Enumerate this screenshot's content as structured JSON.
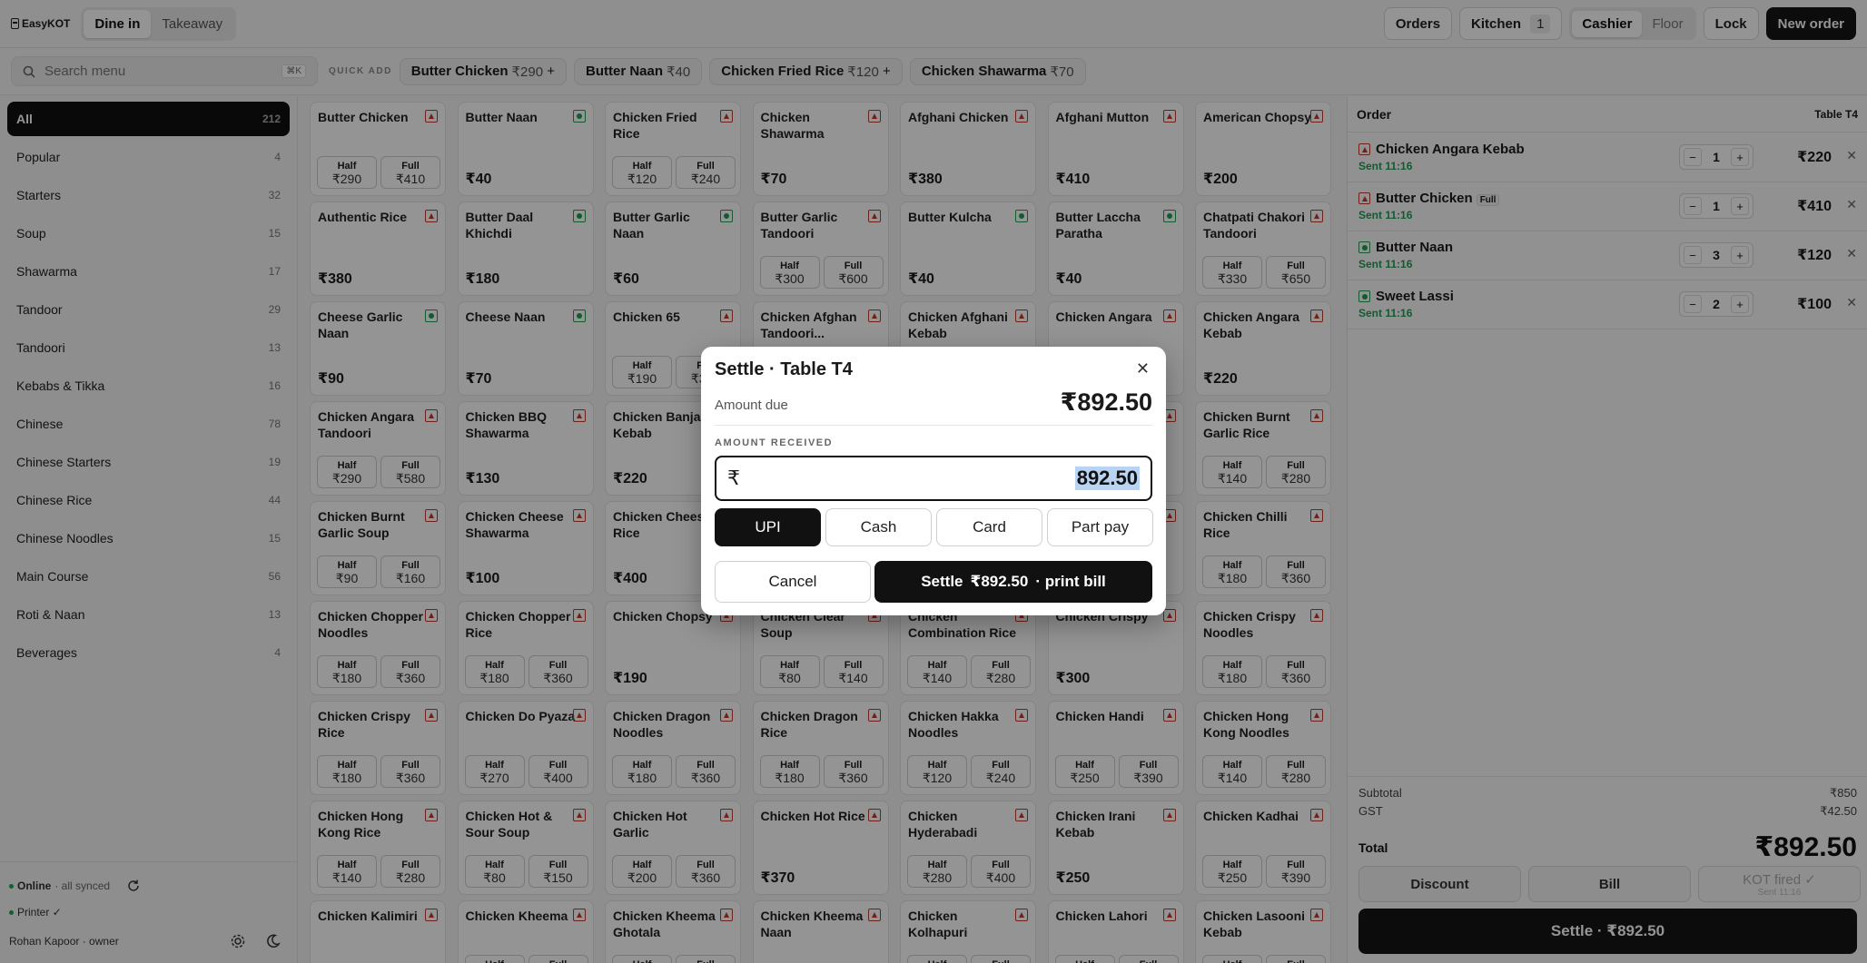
{
  "app": {
    "name": "EasyKOT"
  },
  "modes": [
    {
      "label": "Dine in",
      "active": true
    },
    {
      "label": "Takeaway",
      "active": false
    }
  ],
  "topbar": {
    "orders": "Orders",
    "kitchen": "Kitchen",
    "kitchen_count": "1",
    "roles": [
      {
        "label": "Cashier",
        "active": true
      },
      {
        "label": "Floor",
        "active": false
      }
    ],
    "lock": "Lock",
    "new_order": "New order"
  },
  "search": {
    "placeholder": "Search menu",
    "shortcut": "⌘K"
  },
  "quick_add": {
    "label": "QUICK ADD",
    "items": [
      {
        "name": "Butter Chicken",
        "price": "₹290",
        "more": "+"
      },
      {
        "name": "Butter Naan",
        "price": "₹40",
        "more": ""
      },
      {
        "name": "Chicken Fried Rice",
        "price": "₹120",
        "more": "+"
      },
      {
        "name": "Chicken Shawarma",
        "price": "₹70",
        "more": ""
      }
    ]
  },
  "categories": [
    {
      "label": "All",
      "count": "212",
      "active": true
    },
    {
      "label": "Popular",
      "count": "4"
    },
    {
      "label": "Starters",
      "count": "32"
    },
    {
      "label": "Soup",
      "count": "15"
    },
    {
      "label": "Shawarma",
      "count": "17"
    },
    {
      "label": "Tandoor",
      "count": "29"
    },
    {
      "label": "Tandoori",
      "count": "13"
    },
    {
      "label": "Kebabs & Tikka",
      "count": "16"
    },
    {
      "label": "Chinese",
      "count": "78"
    },
    {
      "label": "Chinese Starters",
      "count": "19"
    },
    {
      "label": "Chinese Rice",
      "count": "44"
    },
    {
      "label": "Chinese Noodles",
      "count": "15"
    },
    {
      "label": "Main Course",
      "count": "56"
    },
    {
      "label": "Roti & Naan",
      "count": "13"
    },
    {
      "label": "Beverages",
      "count": "4"
    }
  ],
  "status": {
    "online": "Online",
    "synced": "· all synced",
    "printer": "Printer ✓",
    "user": "Rohan Kapoor · owner"
  },
  "menu": [
    {
      "name": "Butter Chicken",
      "veg": false,
      "half": "₹290",
      "full": "₹410"
    },
    {
      "name": "Butter Naan",
      "veg": true,
      "price": "₹40"
    },
    {
      "name": "Chicken Fried Rice",
      "veg": false,
      "half": "₹120",
      "full": "₹240"
    },
    {
      "name": "Chicken Shawarma",
      "veg": false,
      "price": "₹70"
    },
    {
      "name": "Afghani Chicken",
      "veg": false,
      "price": "₹380"
    },
    {
      "name": "Afghani Mutton",
      "veg": false,
      "price": "₹410"
    },
    {
      "name": "American Chopsy",
      "veg": false,
      "price": "₹200"
    },
    {
      "name": "Authentic Rice",
      "veg": false,
      "price": "₹380"
    },
    {
      "name": "Butter Daal Khichdi",
      "veg": true,
      "price": "₹180"
    },
    {
      "name": "Butter Garlic Naan",
      "veg": true,
      "price": "₹60"
    },
    {
      "name": "Butter Garlic Tandoori",
      "veg": false,
      "half": "₹300",
      "full": "₹600"
    },
    {
      "name": "Butter Kulcha",
      "veg": true,
      "price": "₹40"
    },
    {
      "name": "Butter Laccha Paratha",
      "veg": true,
      "price": "₹40"
    },
    {
      "name": "Chatpati Chakori Tandoori",
      "veg": false,
      "half": "₹330",
      "full": "₹650"
    },
    {
      "name": "Cheese Garlic Naan",
      "veg": true,
      "price": "₹90"
    },
    {
      "name": "Cheese Naan",
      "veg": true,
      "price": "₹70"
    },
    {
      "name": "Chicken 65",
      "veg": false,
      "half": "₹190",
      "full": "₹380"
    },
    {
      "name": "Chicken Afghan Tandoori...",
      "veg": false,
      "price": ""
    },
    {
      "name": "Chicken Afghani Kebab",
      "veg": false,
      "price": ""
    },
    {
      "name": "Chicken Angara",
      "veg": false,
      "price": ""
    },
    {
      "name": "Chicken Angara Kebab",
      "veg": false,
      "price": "₹220"
    },
    {
      "name": "Chicken Angara Tandoori",
      "veg": false,
      "half": "₹290",
      "full": "₹580"
    },
    {
      "name": "Chicken BBQ Shawarma",
      "veg": false,
      "price": "₹130"
    },
    {
      "name": "Chicken Banjara Kebab",
      "veg": false,
      "price": "₹220"
    },
    {
      "name": "",
      "veg": false,
      "price": ""
    },
    {
      "name": "",
      "veg": false,
      "price": ""
    },
    {
      "name": "",
      "veg": false,
      "price": ""
    },
    {
      "name": "Chicken Burnt Garlic Rice",
      "veg": false,
      "half": "₹140",
      "full": "₹280"
    },
    {
      "name": "Chicken Burnt Garlic Soup",
      "veg": false,
      "half": "₹90",
      "full": "₹160"
    },
    {
      "name": "Chicken Cheese Shawarma",
      "veg": false,
      "price": "₹100"
    },
    {
      "name": "Chicken Cheese Rice",
      "veg": false,
      "price": "₹400"
    },
    {
      "name": "",
      "veg": false,
      "price": ""
    },
    {
      "name": "",
      "veg": false,
      "price": ""
    },
    {
      "name": "",
      "veg": false,
      "price": ""
    },
    {
      "name": "Chicken Chilli Rice",
      "veg": false,
      "half": "₹180",
      "full": "₹360"
    },
    {
      "name": "Chicken Chopper Noodles",
      "veg": false,
      "half": "₹180",
      "full": "₹360"
    },
    {
      "name": "Chicken Chopper Rice",
      "veg": false,
      "half": "₹180",
      "full": "₹360"
    },
    {
      "name": "Chicken Chopsy",
      "veg": false,
      "price": "₹190"
    },
    {
      "name": "Chicken Clear Soup",
      "veg": false,
      "half": "₹80",
      "full": "₹140"
    },
    {
      "name": "Chicken Combination Rice",
      "veg": false,
      "half": "₹140",
      "full": "₹280"
    },
    {
      "name": "Chicken Crispy",
      "veg": false,
      "price": "₹300"
    },
    {
      "name": "Chicken Crispy Noodles",
      "veg": false,
      "half": "₹180",
      "full": "₹360"
    },
    {
      "name": "Chicken Crispy Rice",
      "veg": false,
      "half": "₹180",
      "full": "₹360"
    },
    {
      "name": "Chicken Do Pyaza",
      "veg": false,
      "half": "₹270",
      "full": "₹400"
    },
    {
      "name": "Chicken Dragon Noodles",
      "veg": false,
      "half": "₹180",
      "full": "₹360"
    },
    {
      "name": "Chicken Dragon Rice",
      "veg": false,
      "half": "₹180",
      "full": "₹360"
    },
    {
      "name": "Chicken Hakka Noodles",
      "veg": false,
      "half": "₹120",
      "full": "₹240"
    },
    {
      "name": "Chicken Handi",
      "veg": false,
      "half": "₹250",
      "full": "₹390"
    },
    {
      "name": "Chicken Hong Kong Noodles",
      "veg": false,
      "half": "₹140",
      "full": "₹280"
    },
    {
      "name": "Chicken Hong Kong Rice",
      "veg": false,
      "half": "₹140",
      "full": "₹280"
    },
    {
      "name": "Chicken Hot & Sour Soup",
      "veg": false,
      "half": "₹80",
      "full": "₹150"
    },
    {
      "name": "Chicken Hot Garlic",
      "veg": false,
      "half": "₹200",
      "full": "₹360"
    },
    {
      "name": "Chicken Hot Rice",
      "veg": false,
      "price": "₹370"
    },
    {
      "name": "Chicken Hyderabadi",
      "veg": false,
      "half": "₹280",
      "full": "₹400"
    },
    {
      "name": "Chicken Irani Kebab",
      "veg": false,
      "price": "₹250"
    },
    {
      "name": "Chicken Kadhai",
      "veg": false,
      "half": "₹250",
      "full": "₹390"
    },
    {
      "name": "Chicken Kalimiri",
      "veg": false,
      "price": ""
    },
    {
      "name": "Chicken Kheema",
      "veg": false,
      "half": "",
      "full": ""
    },
    {
      "name": "Chicken Kheema Ghotala",
      "veg": false,
      "half": "",
      "full": ""
    },
    {
      "name": "Chicken Kheema Naan",
      "veg": false,
      "price": ""
    },
    {
      "name": "Chicken Kolhapuri",
      "veg": false,
      "half": "",
      "full": ""
    },
    {
      "name": "Chicken Lahori",
      "veg": false,
      "half": "",
      "full": ""
    },
    {
      "name": "Chicken Lasooni Kebab",
      "veg": false,
      "half": "",
      "full": ""
    }
  ],
  "variant_labels": {
    "half": "Half",
    "full": "Full"
  },
  "order": {
    "title": "Order",
    "table": "Table T4",
    "lines": [
      {
        "name": "Chicken Angara Kebab",
        "tag": "",
        "veg": false,
        "sent": "Sent 11:16",
        "qty": "1",
        "price": "₹220"
      },
      {
        "name": "Butter Chicken",
        "tag": "Full",
        "veg": false,
        "sent": "Sent 11:16",
        "qty": "1",
        "price": "₹410"
      },
      {
        "name": "Butter Naan",
        "tag": "",
        "veg": true,
        "sent": "Sent 11:16",
        "qty": "3",
        "price": "₹120"
      },
      {
        "name": "Sweet Lassi",
        "tag": "",
        "veg": true,
        "sent": "Sent 11:16",
        "qty": "2",
        "price": "₹100"
      }
    ],
    "subtotal_label": "Subtotal",
    "subtotal": "₹850",
    "gst_label": "GST",
    "gst": "₹42.50",
    "total_label": "Total",
    "total": "₹892.50",
    "discount": "Discount",
    "bill": "Bill",
    "kot": "KOT fired ✓",
    "kot_sub": "Sent 11:16",
    "settle": "Settle · ₹892.50"
  },
  "modal": {
    "title": "Settle · Table T4",
    "due_label": "Amount due",
    "due": "₹892.50",
    "received_label": "AMOUNT RECEIVED",
    "currency": "₹",
    "received": "892.50",
    "methods": [
      {
        "label": "UPI",
        "active": true
      },
      {
        "label": "Cash"
      },
      {
        "label": "Card"
      },
      {
        "label": "Part pay"
      }
    ],
    "cancel": "Cancel",
    "settle_label": "Settle",
    "settle_amount": "₹892.50",
    "settle_suffix": "· print bill"
  }
}
